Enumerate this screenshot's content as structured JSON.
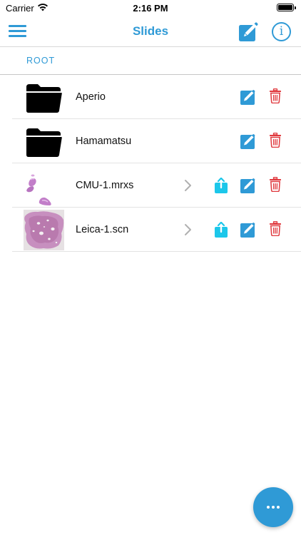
{
  "status_bar": {
    "carrier": "Carrier",
    "time": "2:16 PM",
    "wifi_icon": "wifi-icon",
    "battery_icon": "battery-icon",
    "battery_level": 1.0
  },
  "nav": {
    "title": "Slides",
    "menu_icon": "hamburger-menu-icon",
    "edit_icon": "edit-square-icon",
    "info_icon": "info-circle-icon",
    "info_glyph": "i"
  },
  "section": {
    "label": "ROOT"
  },
  "items": [
    {
      "name": "Aperio",
      "type": "folder",
      "icon": "folder-icon",
      "chevron": false,
      "share": false,
      "edit": true,
      "delete": true
    },
    {
      "name": "Hamamatsu",
      "type": "folder",
      "icon": "folder-icon",
      "chevron": false,
      "share": false,
      "edit": true,
      "delete": true
    },
    {
      "name": "CMU-1.mrxs",
      "type": "slide",
      "icon": "slide-thumbnail",
      "chevron": true,
      "share": true,
      "edit": true,
      "delete": true
    },
    {
      "name": "Leica-1.scn",
      "type": "slide",
      "icon": "slide-thumbnail",
      "chevron": true,
      "share": true,
      "edit": true,
      "delete": true
    }
  ],
  "fab": {
    "icon": "more-dots-icon"
  },
  "colors": {
    "accent": "#2f9ad6",
    "share": "#1cc7ea",
    "delete": "#e0393e",
    "tissue": "#c27ec9",
    "divider": "#e3e3e3"
  }
}
